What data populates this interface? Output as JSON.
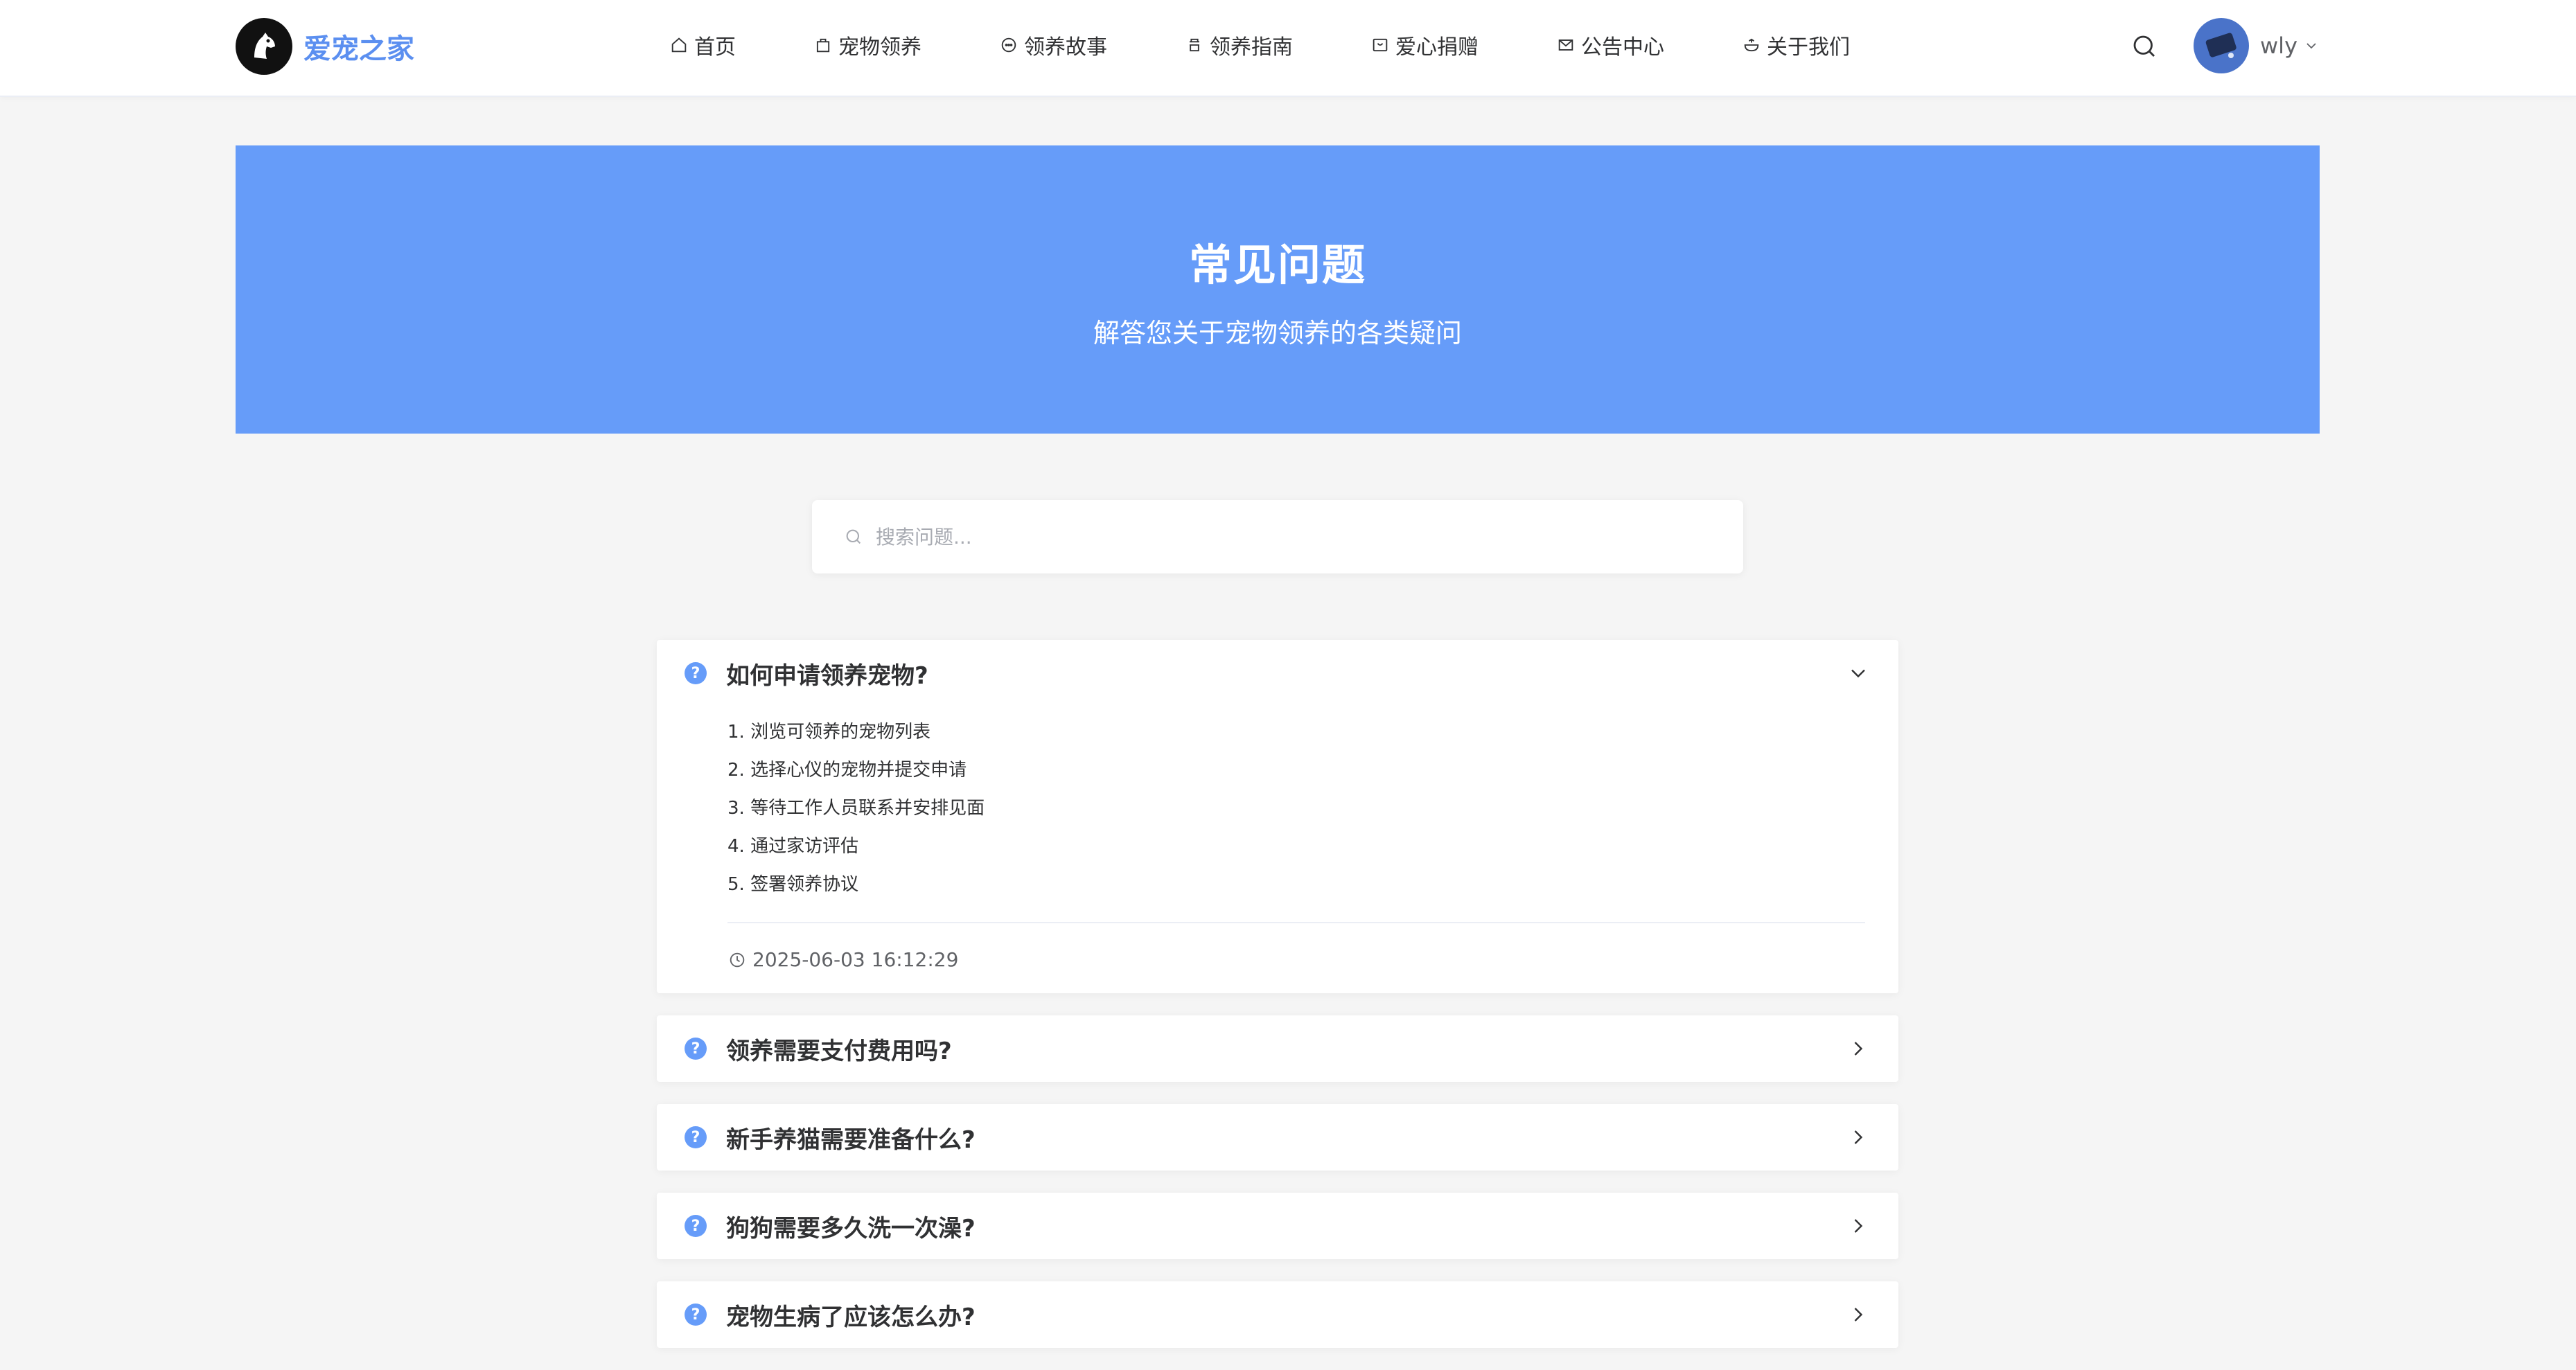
{
  "brand": {
    "name": "爱宠之家",
    "accent": "#5b8ff0"
  },
  "nav": [
    {
      "label": "首页",
      "icon": "home-icon"
    },
    {
      "label": "宠物领养",
      "icon": "bag-icon"
    },
    {
      "label": "领养故事",
      "icon": "chat-icon"
    },
    {
      "label": "领养指南",
      "icon": "guide-icon"
    },
    {
      "label": "爱心捐赠",
      "icon": "gift-icon"
    },
    {
      "label": "公告中心",
      "icon": "mail-icon"
    },
    {
      "label": "关于我们",
      "icon": "bowl-icon"
    }
  ],
  "user": {
    "name": "wly"
  },
  "hero": {
    "title": "常见问题",
    "subtitle": "解答您关于宠物领养的各类疑问",
    "background": "#669cf9"
  },
  "search": {
    "placeholder": "搜索问题..."
  },
  "faqs": [
    {
      "question": "如何申请领养宠物?",
      "expanded": true,
      "answer_steps": [
        "1. 浏览可领养的宠物列表",
        "2. 选择心仪的宠物并提交申请",
        "3. 等待工作人员联系并安排见面",
        "4. 通过家访评估",
        "5. 签署领养协议"
      ],
      "updated": "2025-06-03 16:12:29"
    },
    {
      "question": "领养需要支付费用吗?",
      "expanded": false
    },
    {
      "question": "新手养猫需要准备什么?",
      "expanded": false
    },
    {
      "question": "狗狗需要多久洗一次澡?",
      "expanded": false
    },
    {
      "question": "宠物生病了应该怎么办?",
      "expanded": false
    }
  ]
}
